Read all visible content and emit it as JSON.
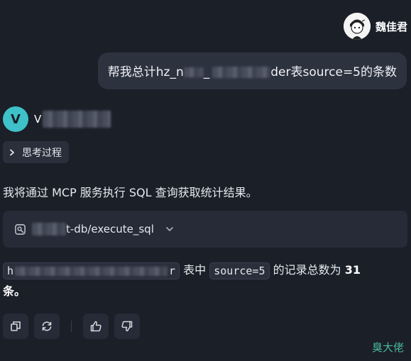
{
  "user": {
    "name": "魏佳君",
    "message_prefix": "帮我总计hz_n",
    "message_mid": "_",
    "message_partial": "der",
    "message_suffix": "表source=5的条数"
  },
  "assistant": {
    "avatar_letter": "V",
    "name_visible_char": "V",
    "think_label": "思考过程",
    "intro_text": "我将通过 MCP 服务执行 SQL 查询获取统计结果。",
    "tool_call": {
      "label_visible": "t-db/execute_sql",
      "icon": "tool-icon",
      "expand_icon": "chevron-down-icon"
    },
    "result": {
      "table_code_start": "h",
      "table_code_end": "r",
      "text_1": " 表中 ",
      "code_2": "source=5",
      "text_2": " 的记录总数为 ",
      "count": "31",
      "text_3": "条。"
    }
  },
  "actions": [
    "copy-icon",
    "regenerate-icon",
    "thumbs-up-icon",
    "thumbs-down-icon"
  ],
  "watermark": "臭大佬",
  "colors": {
    "background": "#1b1f28",
    "bubble": "#2d323f",
    "avatar_teal": "#3ec1c9",
    "watermark": "#49b89c"
  }
}
